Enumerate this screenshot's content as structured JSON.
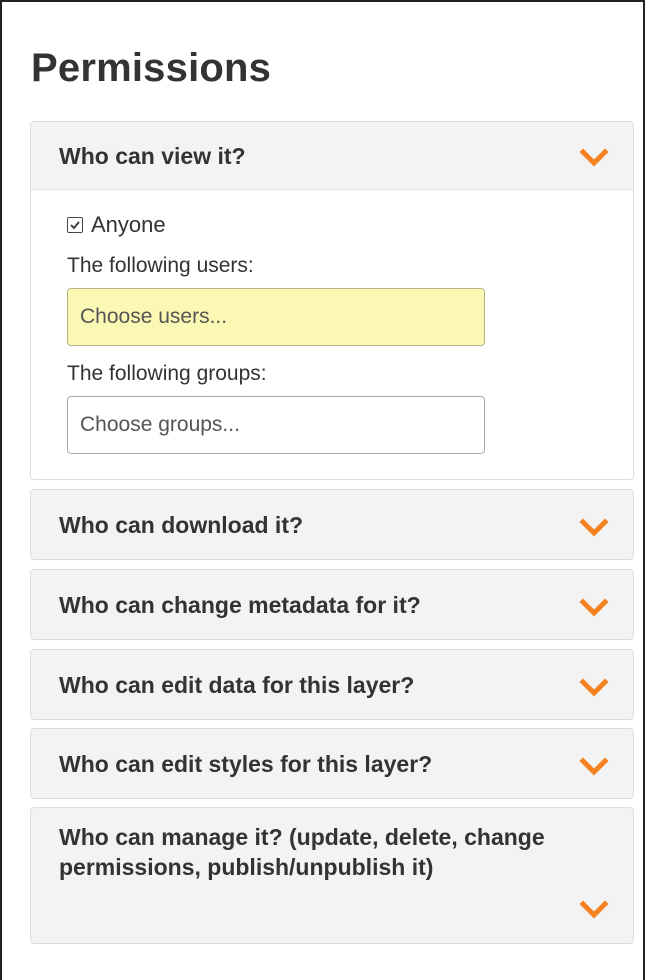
{
  "page_title": "Permissions",
  "accent_color": "#f58220",
  "panels": [
    {
      "title": "Who can view it?",
      "expanded": true,
      "anyone_label": "Anyone",
      "anyone_checked": true,
      "users_label": "The following users:",
      "users_placeholder": "Choose users...",
      "groups_label": "The following groups:",
      "groups_placeholder": "Choose groups..."
    },
    {
      "title": "Who can download it?",
      "expanded": false
    },
    {
      "title": "Who can change metadata for it?",
      "expanded": false
    },
    {
      "title": "Who can edit data for this layer?",
      "expanded": false
    },
    {
      "title": "Who can edit styles for this layer?",
      "expanded": false
    },
    {
      "title": "Who can manage it? (update, delete, change permissions, publish/unpublish it)",
      "expanded": false
    }
  ],
  "icons": {
    "toggle": "chevron-down-icon",
    "checkbox": "checkbox-checked-icon"
  }
}
